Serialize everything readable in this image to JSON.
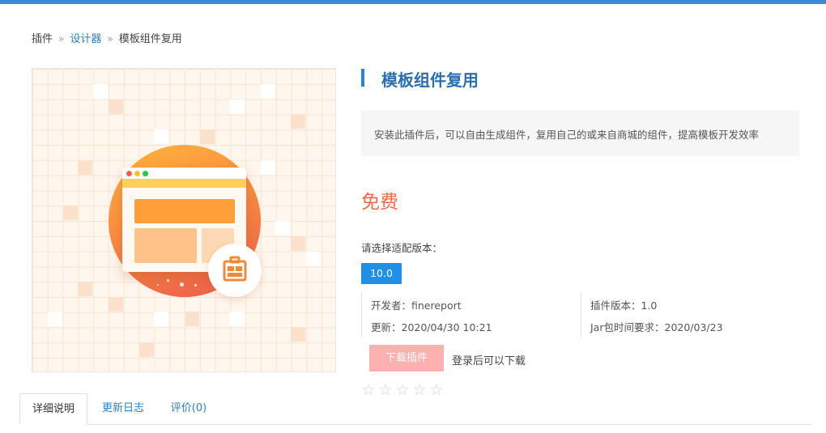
{
  "breadcrumb": {
    "items": [
      "插件",
      "设计器",
      "模板组件复用"
    ],
    "separator": "»"
  },
  "hero": {
    "icon": "plugin-template-illustration",
    "badge_icon": "briefcase-icon"
  },
  "plugin": {
    "title": "模板组件复用",
    "description": "安装此插件后，可以自由生成组件，复用自己的或来自商城的组件，提高模板开发效率",
    "price": "免费",
    "version_label": "请选择适配版本：",
    "version": "10.0",
    "developer": "开发者：finereport",
    "updated": "更新：2020/04/30 10:21",
    "plugin_version": "插件版本：1.0",
    "jar_requirement": "Jar包时间要求：2020/03/23"
  },
  "actions": {
    "download_label": "下载插件",
    "login_tip": "登录后可以下载"
  },
  "rating": {
    "stars": [
      "☆",
      "☆",
      "☆",
      "☆",
      "☆"
    ],
    "filled": 0
  },
  "tabs": [
    {
      "label": "详细说明"
    },
    {
      "label": "更新日志"
    },
    {
      "label": "评价(0)"
    }
  ],
  "colors": {
    "accent": "#2b82d4",
    "price": "#ee6a4c",
    "version_chip": "#1e90e8",
    "download_disabled": "#fcb1b0"
  }
}
